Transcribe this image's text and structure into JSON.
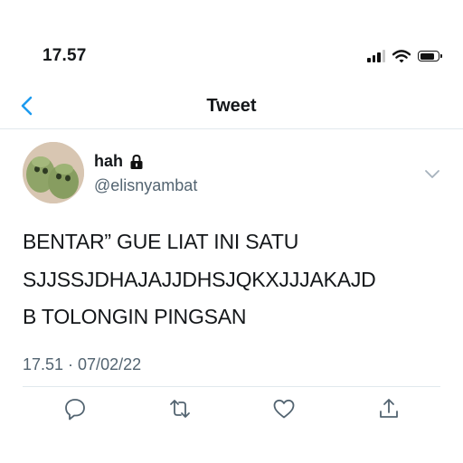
{
  "status_bar": {
    "time": "17.57"
  },
  "nav": {
    "title": "Tweet",
    "back_icon": "chevron-left-icon"
  },
  "tweet": {
    "display_name": "hah",
    "handle": "@elisnyambat",
    "text_lines": [
      "BENTAR” GUE LIAT INI SATU",
      "SJJSSJDHAJAJJDHSJQKXJJJAKAJD",
      "B TOLONGIN PINGSAN"
    ],
    "timestamp": "17.51 · 07/02/22",
    "actions": [
      "reply-icon",
      "retweet-icon",
      "like-icon",
      "share-icon"
    ]
  },
  "colors": {
    "accent": "#1d9bf0",
    "secondary_text": "#536471",
    "divider": "#e1e8ed"
  }
}
